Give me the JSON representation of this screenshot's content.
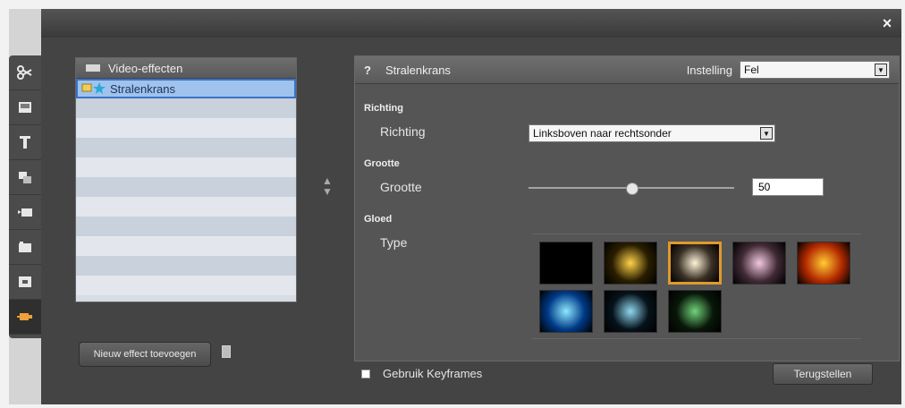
{
  "window": {
    "close_glyph": "×"
  },
  "toolbar": {
    "items": [
      {
        "icon": "scissors-icon"
      },
      {
        "icon": "image-edit-icon"
      },
      {
        "icon": "text-icon"
      },
      {
        "icon": "transition-icon"
      },
      {
        "icon": "camera-effect-icon"
      },
      {
        "icon": "clip-icon"
      },
      {
        "icon": "display-icon"
      },
      {
        "icon": "plugin-icon"
      }
    ],
    "active_index": 7
  },
  "effects_list": {
    "title": "Video-effecten",
    "selected_item": "Stralenkrans"
  },
  "buttons": {
    "add_effect": "Nieuw effect toevoegen",
    "reset": "Terugstellen"
  },
  "settings": {
    "effect_name": "Stralenkrans",
    "help_glyph": "?",
    "preset_label": "Instelling",
    "preset_value": "Fel",
    "sections": {
      "direction_header": "Richting",
      "direction_label": "Richting",
      "direction_value": "Linksboven naar rechtsonder",
      "size_header": "Grootte",
      "size_label": "Grootte",
      "size_value": "50",
      "glow_header": "Gloed",
      "glow_label": "Type"
    },
    "slider_fraction": 0.5
  },
  "glow_types": [
    {
      "center": "#000000",
      "edge": "#000000"
    },
    {
      "center": "#ffd24a",
      "edge": "#2a1e00"
    },
    {
      "center": "#fff4d8",
      "edge": "#3a3026"
    },
    {
      "center": "#f2c8e0",
      "edge": "#402a34"
    },
    {
      "center": "#ffcc33",
      "edge": "#b42a00"
    },
    {
      "center": "#8ee8ff",
      "edge": "#003a88"
    },
    {
      "center": "#8fd7f0",
      "edge": "#06121a"
    },
    {
      "center": "#6fd37a",
      "edge": "#091709"
    }
  ],
  "glow_selected": 2,
  "keyframes": {
    "label": "Gebruik Keyframes"
  },
  "colors": {
    "accent": "#e09a2a",
    "list_selected": "#9fc3ec"
  }
}
